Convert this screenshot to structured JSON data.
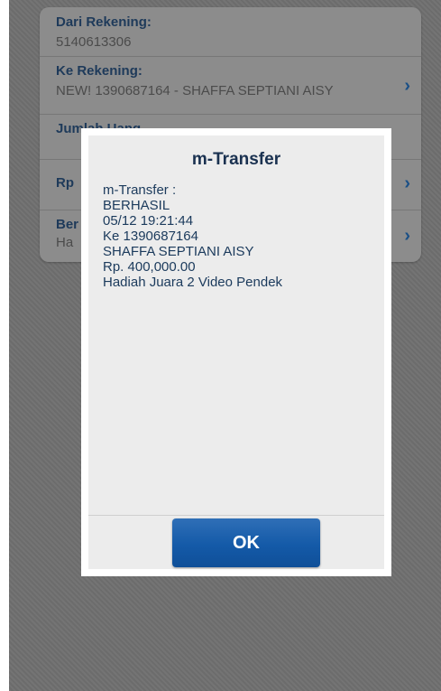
{
  "form": {
    "rows": [
      {
        "label": "Dari Rekening:",
        "value": "5140613306"
      },
      {
        "label": "Ke Rekening:",
        "value": "NEW! 1390687164 - SHAFFA SEPTIANI AISY"
      },
      {
        "label": "Jumlah Uang",
        "value": ""
      },
      {
        "label": "Rp",
        "value": ""
      },
      {
        "label": "Ber",
        "value": "Ha"
      }
    ]
  },
  "dialog": {
    "title": "m-Transfer",
    "lines": [
      "m-Transfer :",
      "BERHASIL",
      "05/12 19:21:44",
      "Ke 1390687164",
      "SHAFFA SEPTIANI AISY",
      "Rp. 400,000.00",
      "Hadiah Juara 2 Video Pendek"
    ],
    "ok_label": "OK"
  },
  "icons": {
    "chevron": "›"
  }
}
